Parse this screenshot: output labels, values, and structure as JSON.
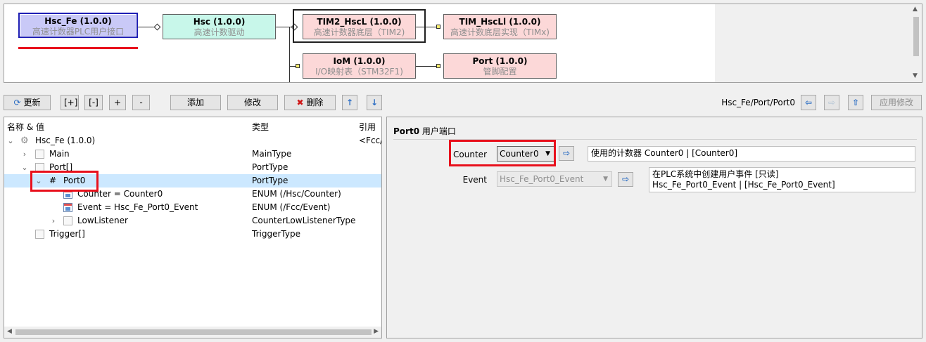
{
  "diagram": {
    "nodes": [
      {
        "id": "hsc_fe",
        "title": "Hsc_Fe (1.0.0)",
        "subtitle": "高速计数器PLC用户接口",
        "color": "#c9c9f7"
      },
      {
        "id": "hsc",
        "title": "Hsc (1.0.0)",
        "subtitle": "高速计数驱动",
        "color": "#c8f7ea"
      },
      {
        "id": "tim2_hscl",
        "title": "TIM2_HscL (1.0.0)",
        "subtitle": "高速计数器底层（TIM2)",
        "color": "#fcd8d8"
      },
      {
        "id": "tim_hscll",
        "title": "TIM_HscLl (1.0.0)",
        "subtitle": "高速计数底层实现（TIMx)",
        "color": "#fcd8d8"
      },
      {
        "id": "iom",
        "title": "IoM (1.0.0)",
        "subtitle": "I/O映射表（STM32F1)",
        "color": "#fcd8d8"
      },
      {
        "id": "port",
        "title": "Port (1.0.0)",
        "subtitle": "管脚配置",
        "color": "#fcd8d8"
      }
    ]
  },
  "toolbar": {
    "refresh": "更新",
    "expand_all": "[+]",
    "collapse_all": "[-]",
    "expand": "+",
    "collapse": "-",
    "add": "添加",
    "modify": "修改",
    "delete": "删除",
    "path": "Hsc_Fe/Port/Port0",
    "apply": "应用修改"
  },
  "tree": {
    "columns": {
      "name": "名称 & 值",
      "type": "类型",
      "ref": "引用"
    },
    "rows": [
      {
        "name": "Hsc_Fe (1.0.0)",
        "type": "",
        "ref": "<Fcc/I",
        "expander": "⌄",
        "icon": "gear-icon"
      },
      {
        "name": "Main",
        "type": "MainType",
        "ref": "",
        "expander": "›",
        "icon": "folder-icon"
      },
      {
        "name": "Port[]",
        "type": "PortType",
        "ref": "",
        "expander": "⌄",
        "icon": "folder-icon"
      },
      {
        "name": "Port0",
        "type": "PortType",
        "ref": "",
        "expander": "⌄",
        "icon": "hash-icon",
        "glyph": "#"
      },
      {
        "name": "Counter = Counter0",
        "type": "ENUM (/Hsc/Counter)",
        "ref": "",
        "expander": "",
        "icon": "enum-icon"
      },
      {
        "name": "Event = Hsc_Fe_Port0_Event",
        "type": "ENUM (/Fcc/Event)",
        "ref": "",
        "expander": "",
        "icon": "enum-icon"
      },
      {
        "name": "LowListener",
        "type": "CounterLowListenerType",
        "ref": "",
        "expander": "›",
        "icon": "folder-icon"
      },
      {
        "name": "Trigger[]",
        "type": "TriggerType",
        "ref": "",
        "expander": "",
        "icon": "folder-icon"
      }
    ]
  },
  "detail": {
    "title_bold": "Port0",
    "title_rest": "用户端口",
    "counter": {
      "label": "Counter",
      "value": "Counter0",
      "description": "使用的计数器 Counter0 | [Counter0]"
    },
    "event": {
      "label": "Event",
      "value": "Hsc_Fe_Port0_Event",
      "description_line1": "在PLC系统中创建用户事件 [只读]",
      "description_line2": "Hsc_Fe_Port0_Event | [Hsc_Fe_Port0_Event]"
    }
  },
  "colors": {
    "highlight_red": "#e8101c",
    "selection": "#cce8ff",
    "selected_node_border": "#1e1eb4"
  }
}
